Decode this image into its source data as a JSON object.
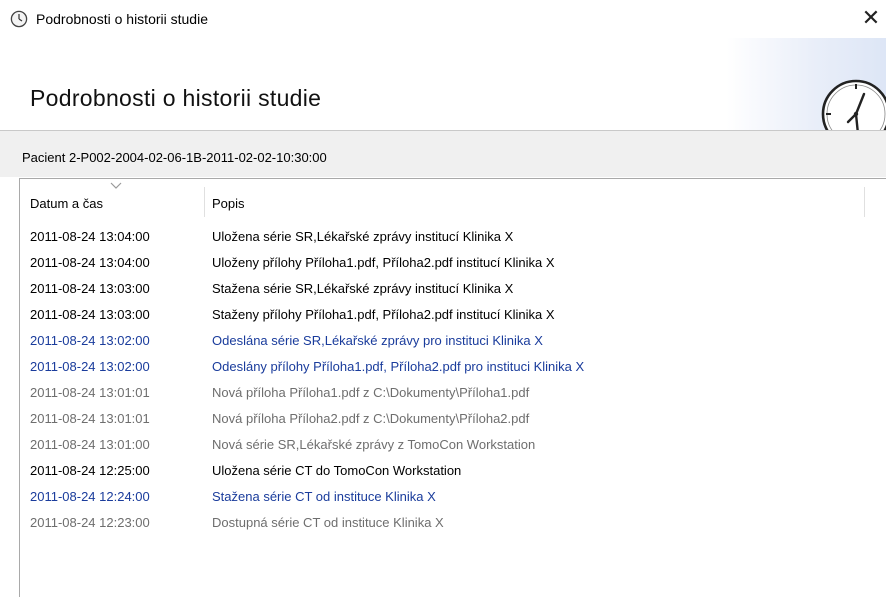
{
  "window": {
    "title": "Podrobnosti o historii studie",
    "close_glyph": "✕",
    "icon": "clock-icon"
  },
  "header": {
    "heading": "Podrobnosti o historii studie",
    "icon": "clock-icon"
  },
  "patient": {
    "label": "Pacient 2-P002-2004-02-06-1B-2011-02-02-10:30:00"
  },
  "list": {
    "columns": [
      {
        "label": "Datum a čas",
        "sorted": true
      },
      {
        "label": "Popis"
      }
    ],
    "status_colors": {
      "black": "#000000",
      "blue": "#1a3c9c",
      "gray": "#6e6e6e"
    },
    "rows": [
      {
        "date": "2011-08-24 13:04:00",
        "description": "Uložena série SR,Lékařské zprávy institucí Klinika X",
        "status": "black"
      },
      {
        "date": "2011-08-24 13:04:00",
        "description": "Uloženy přílohy Příloha1.pdf, Příloha2.pdf institucí Klinika X",
        "status": "black"
      },
      {
        "date": "2011-08-24 13:03:00",
        "description": "Stažena série SR,Lékařské zprávy institucí Klinika X",
        "status": "black"
      },
      {
        "date": "2011-08-24 13:03:00",
        "description": "Staženy přílohy Příloha1.pdf, Příloha2.pdf institucí Klinika X",
        "status": "black"
      },
      {
        "date": "2011-08-24 13:02:00",
        "description": "Odeslána série SR,Lékařské zprávy pro instituci Klinika X",
        "status": "blue"
      },
      {
        "date": "2011-08-24 13:02:00",
        "description": "Odeslány přílohy Příloha1.pdf, Příloha2.pdf pro instituci Klinika X",
        "status": "blue"
      },
      {
        "date": "2011-08-24 13:01:01",
        "description": "Nová příloha Příloha1.pdf z C:\\Dokumenty\\Příloha1.pdf",
        "status": "gray"
      },
      {
        "date": "2011-08-24 13:01:01",
        "description": "Nová příloha Příloha2.pdf z C:\\Dokumenty\\Příloha2.pdf",
        "status": "gray"
      },
      {
        "date": "2011-08-24 13:01:00",
        "description": "Nová série SR,Lékařské zprávy z TomoCon Workstation",
        "status": "gray"
      },
      {
        "date": "2011-08-24 12:25:00",
        "description": "Uložena série CT do TomoCon Workstation",
        "status": "black"
      },
      {
        "date": "2011-08-24 12:24:00",
        "description": "Stažena série CT od instituce Klinika X",
        "status": "blue"
      },
      {
        "date": "2011-08-24 12:23:00",
        "description": "Dostupná série CT od instituce Klinika X",
        "status": "gray"
      }
    ]
  }
}
